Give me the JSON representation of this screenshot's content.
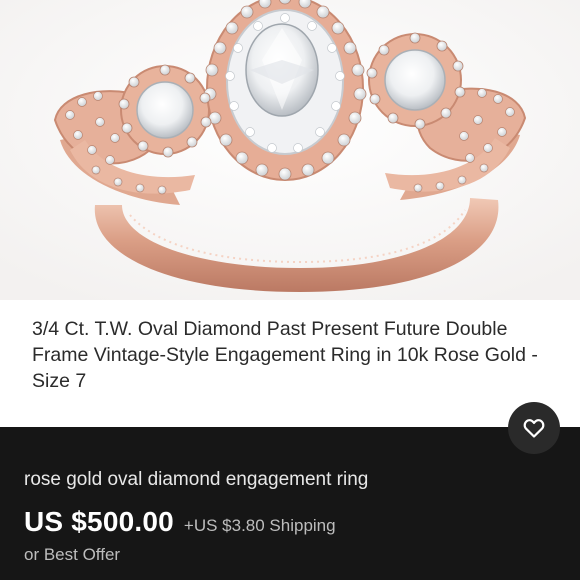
{
  "listing": {
    "image_alt_icon": "rose-gold-ring-photo",
    "title": "3/4 Ct. T.W. Oval Diamond Past Present Future Double Frame Vintage-Style Engagement Ring in 10k Rose Gold - Size 7",
    "subtitle": "rose gold oval diamond engagement ring",
    "price": "US $500.00",
    "shipping": "+US $3.80 Shipping",
    "offer": "or Best Offer",
    "favorite_icon": "heart-icon"
  },
  "colors": {
    "rose_gold": "#d9a088",
    "panel_background": "#161616",
    "price_text": "#ffffff"
  }
}
